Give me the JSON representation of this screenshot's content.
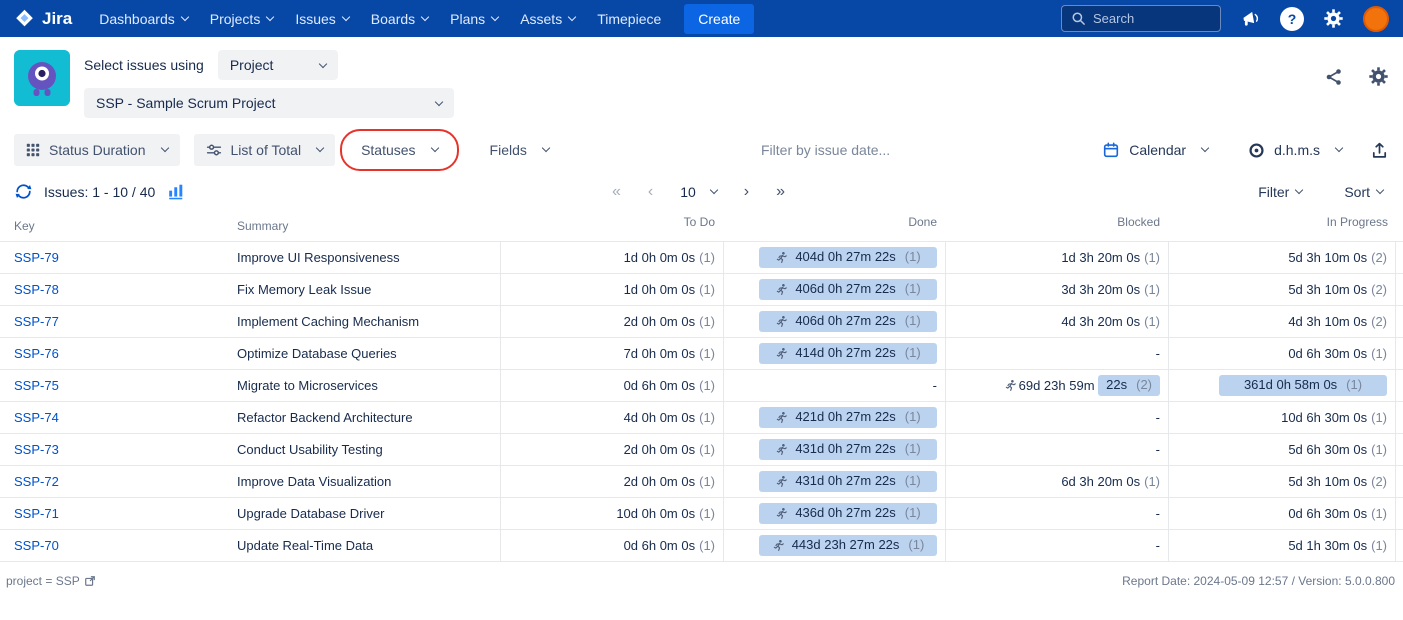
{
  "topnav": {
    "brand": "Jira",
    "items": [
      {
        "label": "Dashboards",
        "dropdown": true
      },
      {
        "label": "Projects",
        "dropdown": true
      },
      {
        "label": "Issues",
        "dropdown": true
      },
      {
        "label": "Boards",
        "dropdown": true
      },
      {
        "label": "Plans",
        "dropdown": true
      },
      {
        "label": "Assets",
        "dropdown": true
      },
      {
        "label": "Timepiece",
        "dropdown": false
      }
    ],
    "create_label": "Create",
    "search_placeholder": "Search"
  },
  "header": {
    "select_issues_label": "Select issues using",
    "issue_source_value": "Project",
    "project_value": "SSP - Sample Scrum Project"
  },
  "toolbar": {
    "report_type": "Status Duration",
    "view_mode": "List of Total",
    "statuses_label": "Statuses",
    "fields_label": "Fields",
    "date_filter_placeholder": "Filter by issue date...",
    "calendar_label": "Calendar",
    "duration_format": "d.h.m.s"
  },
  "pagination": {
    "issues_label": "Issues: 1 - 10 / 40",
    "first": "«",
    "prev": "‹",
    "page_size": "10",
    "next": "›",
    "last": "»",
    "filter_label": "Filter",
    "sort_label": "Sort"
  },
  "table": {
    "columns": [
      "Key",
      "Summary",
      "To Do",
      "Done",
      "Blocked",
      "In Progress"
    ],
    "rows": [
      {
        "key": "SSP-79",
        "summary": "Improve UI Responsiveness",
        "todo": {
          "value": "1d 0h 0m 0s",
          "count": "(1)"
        },
        "done": {
          "value": "404d 0h 27m 22s",
          "count": "(1)",
          "chip": "full",
          "runner": true
        },
        "blocked": {
          "value": "1d 3h 20m 0s",
          "count": "(1)"
        },
        "in_progress": {
          "value": "5d 3h 10m 0s",
          "count": "(2)"
        }
      },
      {
        "key": "SSP-78",
        "summary": "Fix Memory Leak Issue",
        "todo": {
          "value": "1d 0h 0m 0s",
          "count": "(1)"
        },
        "done": {
          "value": "406d 0h 27m 22s",
          "count": "(1)",
          "chip": "full",
          "runner": true
        },
        "blocked": {
          "value": "3d 3h 20m 0s",
          "count": "(1)"
        },
        "in_progress": {
          "value": "5d 3h 10m 0s",
          "count": "(2)"
        }
      },
      {
        "key": "SSP-77",
        "summary": "Implement Caching Mechanism",
        "todo": {
          "value": "2d 0h 0m 0s",
          "count": "(1)"
        },
        "done": {
          "value": "406d 0h 27m 22s",
          "count": "(1)",
          "chip": "full",
          "runner": true
        },
        "blocked": {
          "value": "4d 3h 20m 0s",
          "count": "(1)"
        },
        "in_progress": {
          "value": "4d 3h 10m 0s",
          "count": "(2)"
        }
      },
      {
        "key": "SSP-76",
        "summary": "Optimize Database Queries",
        "todo": {
          "value": "7d 0h 0m 0s",
          "count": "(1)"
        },
        "done": {
          "value": "414d 0h 27m 22s",
          "count": "(1)",
          "chip": "full",
          "runner": true
        },
        "blocked": {
          "value": "-"
        },
        "in_progress": {
          "value": "0d 6h 30m 0s",
          "count": "(1)"
        }
      },
      {
        "key": "SSP-75",
        "summary": "Migrate to Microservices",
        "todo": {
          "value": "0d 6h 0m 0s",
          "count": "(1)"
        },
        "done": {
          "value": "-"
        },
        "blocked": {
          "value": "69d 23h 59m 22s",
          "count": "(2)",
          "chip": "partial",
          "runner": true
        },
        "in_progress": {
          "value": "361d 0h 58m 0s",
          "count": "(1)",
          "chip": "full",
          "runner": false
        }
      },
      {
        "key": "SSP-74",
        "summary": "Refactor Backend Architecture",
        "todo": {
          "value": "4d 0h 0m 0s",
          "count": "(1)"
        },
        "done": {
          "value": "421d 0h 27m 22s",
          "count": "(1)",
          "chip": "full",
          "runner": true
        },
        "blocked": {
          "value": "-"
        },
        "in_progress": {
          "value": "10d 6h 30m 0s",
          "count": "(1)"
        }
      },
      {
        "key": "SSP-73",
        "summary": "Conduct Usability Testing",
        "todo": {
          "value": "2d 0h 0m 0s",
          "count": "(1)"
        },
        "done": {
          "value": "431d 0h 27m 22s",
          "count": "(1)",
          "chip": "full",
          "runner": true
        },
        "blocked": {
          "value": "-"
        },
        "in_progress": {
          "value": "5d 6h 30m 0s",
          "count": "(1)"
        }
      },
      {
        "key": "SSP-72",
        "summary": "Improve Data Visualization",
        "todo": {
          "value": "2d 0h 0m 0s",
          "count": "(1)"
        },
        "done": {
          "value": "431d 0h 27m 22s",
          "count": "(1)",
          "chip": "full",
          "runner": true
        },
        "blocked": {
          "value": "6d 3h 20m 0s",
          "count": "(1)"
        },
        "in_progress": {
          "value": "5d 3h 10m 0s",
          "count": "(2)"
        }
      },
      {
        "key": "SSP-71",
        "summary": "Upgrade Database Driver",
        "todo": {
          "value": "10d 0h 0m 0s",
          "count": "(1)"
        },
        "done": {
          "value": "436d 0h 27m 22s",
          "count": "(1)",
          "chip": "full",
          "runner": true
        },
        "blocked": {
          "value": "-"
        },
        "in_progress": {
          "value": "0d 6h 30m 0s",
          "count": "(1)"
        }
      },
      {
        "key": "SSP-70",
        "summary": "Update Real-Time Data",
        "todo": {
          "value": "0d 6h 0m 0s",
          "count": "(1)"
        },
        "done": {
          "value": "443d 23h 27m 22s",
          "count": "(1)",
          "chip": "full",
          "runner": true
        },
        "blocked": {
          "value": "-"
        },
        "in_progress": {
          "value": "5d 1h 30m 0s",
          "count": "(1)"
        }
      }
    ]
  },
  "footer": {
    "query": "project = SSP",
    "report_info": "Report Date: 2024-05-09 12:57 / Version: 5.0.0.800"
  },
  "colors": {
    "navbar": "#0747A6",
    "create_button": "#0C66E4",
    "link": "#0052CC",
    "chip_background": "#BCD3F0",
    "annotation": "#E5352B"
  }
}
